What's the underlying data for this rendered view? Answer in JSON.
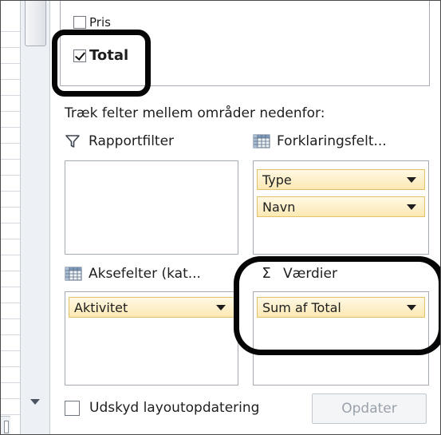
{
  "field_list": {
    "items": [
      {
        "label": "Pris",
        "checked": false
      },
      {
        "label": "Total",
        "checked": true
      }
    ]
  },
  "instruction": "Træk felter mellem områder nedenfor:",
  "areas": {
    "report_filter": {
      "title": "Rapportfilter",
      "icon": "filter-icon",
      "fields": []
    },
    "legend_fields": {
      "title": "Forklaringsfelt...",
      "icon": "grid-icon",
      "fields": [
        "Type",
        "Navn"
      ]
    },
    "axis_fields": {
      "title": "Aksefelter (kat...",
      "icon": "grid-icon",
      "fields": [
        "Aktivitet"
      ]
    },
    "values": {
      "title": "Værdier",
      "icon": "sigma-icon",
      "symbol": "Σ",
      "fields": [
        "Sum af Total"
      ]
    }
  },
  "footer": {
    "defer_label": "Udskyd layoutopdatering",
    "defer_checked": false,
    "update_label": "Opdater"
  },
  "colors": {
    "field_chip_fill": "#fbe8b2",
    "field_chip_border": "#e3c169",
    "annotation_stroke": "#050505"
  }
}
